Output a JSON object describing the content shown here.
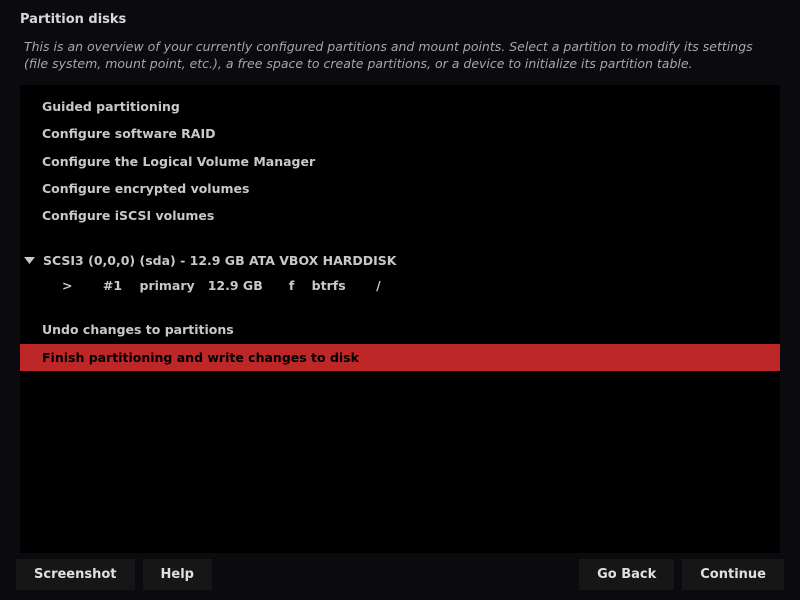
{
  "title": "Partition disks",
  "description": "This is an overview of your currently configured partitions and mount points. Select a partition to modify its settings (file system, mount point, etc.), a free space to create partitions, or a device to initialize its partition table.",
  "options_top": [
    "Guided partitioning",
    "Configure software RAID",
    "Configure the Logical Volume Manager",
    "Configure encrypted volumes",
    "Configure iSCSI volumes"
  ],
  "disk": {
    "label": "SCSI3 (0,0,0) (sda) - 12.9 GB ATA VBOX HARDDISK",
    "partition": {
      "marker": ">",
      "num": "#1",
      "type": "primary",
      "size": "12.9 GB",
      "flag": "f",
      "fs": "btrfs",
      "mount": "/"
    }
  },
  "options_bottom": [
    {
      "label": "Undo changes to partitions",
      "selected": false
    },
    {
      "label": "Finish partitioning and write changes to disk",
      "selected": true
    }
  ],
  "buttons": {
    "screenshot": "Screenshot",
    "help": "Help",
    "go_back": "Go Back",
    "continue": "Continue"
  }
}
